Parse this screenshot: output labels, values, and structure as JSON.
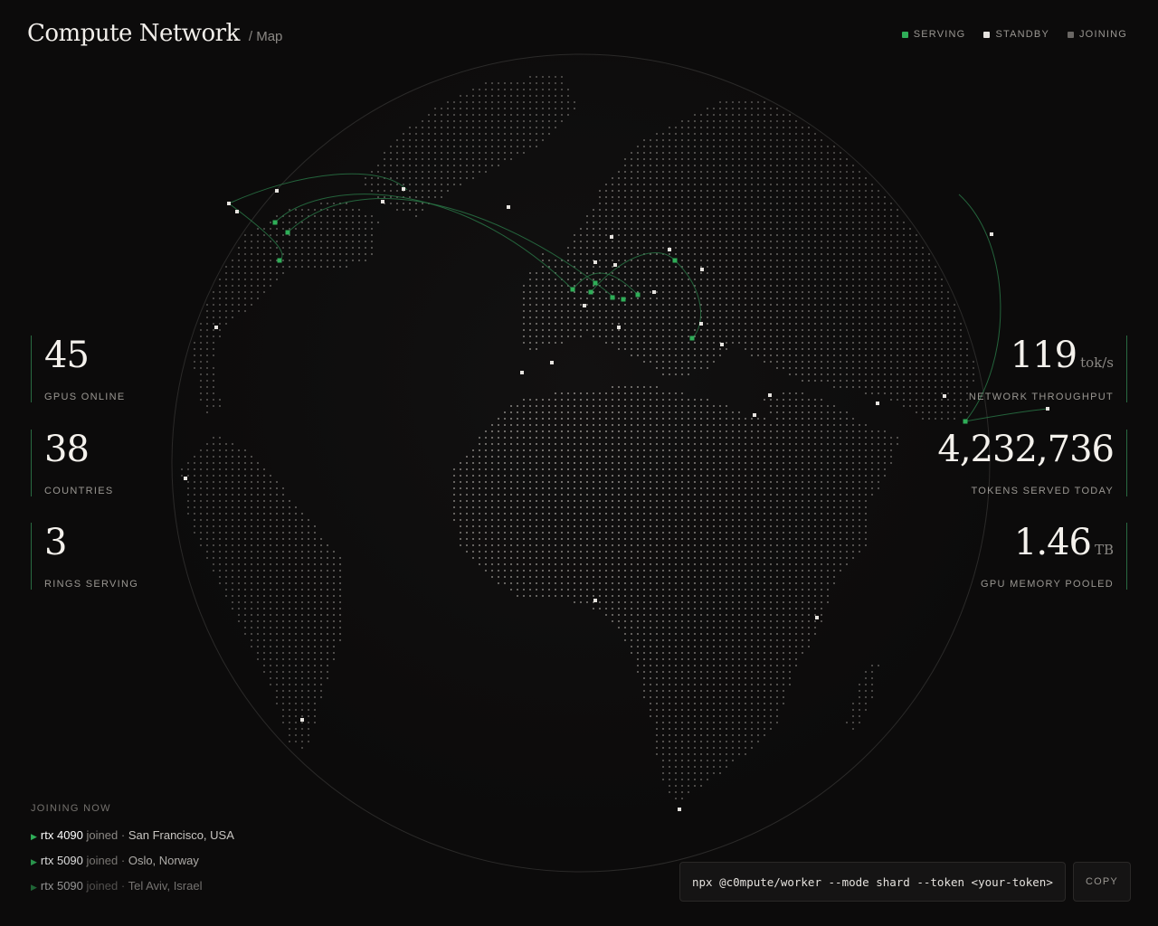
{
  "header": {
    "title": "Compute Network",
    "subtitle": "/ Map"
  },
  "legend": {
    "items": [
      {
        "label": "SERVING",
        "color": "#2fae58"
      },
      {
        "label": "STANDBY",
        "color": "#e6e3df"
      },
      {
        "label": "JOINING",
        "color": "#6a6764"
      }
    ]
  },
  "stats_left": [
    {
      "value": "45",
      "label": "GPUS ONLINE"
    },
    {
      "value": "38",
      "label": "COUNTRIES"
    },
    {
      "value": "3",
      "label": "RINGS SERVING"
    }
  ],
  "stats_right": [
    {
      "value": "119",
      "unit": "tok/s",
      "label": "NETWORK THROUGHPUT"
    },
    {
      "value": "4,232,736",
      "unit": "",
      "label": "TOKENS SERVED TODAY"
    },
    {
      "value": "1.46",
      "unit": "TB",
      "label": "GPU MEMORY POOLED"
    }
  ],
  "joining": {
    "title": "JOINING NOW",
    "rows": [
      {
        "gpu": "rtx 4090",
        "verb": "joined",
        "location": "San Francisco, USA"
      },
      {
        "gpu": "rtx 5090",
        "verb": "joined",
        "location": "Oslo, Norway"
      },
      {
        "gpu": "rtx 5090",
        "verb": "joined",
        "location": "Tel Aviv, Israel"
      }
    ]
  },
  "command": {
    "text": "npx @c0mpute/worker --mode shard --token <your-token>",
    "copy_label": "COPY"
  },
  "colors": {
    "accent": "#2fae58",
    "background": "#0c0b0b",
    "standby": "#e6e3df"
  }
}
